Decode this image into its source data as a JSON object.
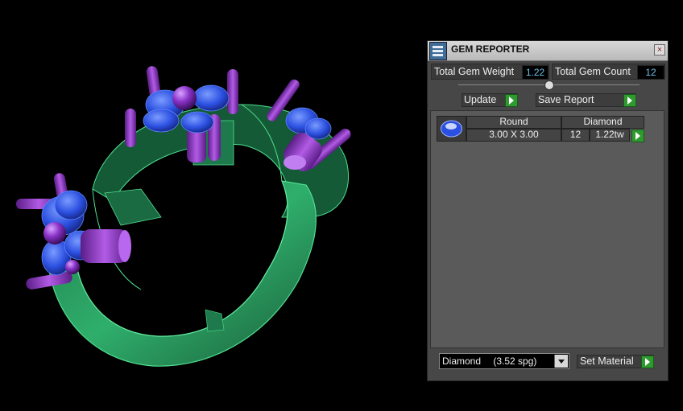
{
  "panel": {
    "title": "GEM REPORTER",
    "close_symbol": "×",
    "total_weight_label": "Total Gem Weight",
    "total_weight_value": "1.22",
    "total_count_label": "Total Gem Count",
    "total_count_value": "12",
    "update_label": "Update",
    "save_report_label": "Save Report",
    "report_row": {
      "shape": "Round",
      "material": "Diamond",
      "size": "3.00 X 3.00",
      "count": "12",
      "weight": "1.22tw"
    },
    "material_select": {
      "name": "Diamond",
      "sg": "(3.52 spg)"
    },
    "set_material_label": "Set Material"
  },
  "colors": {
    "band": "#2fae6b",
    "prong": "#9a3fd0",
    "gem": "#2f59e6",
    "accent_value": "#6ec0e8",
    "arrow_button": "#2f9a2f"
  }
}
